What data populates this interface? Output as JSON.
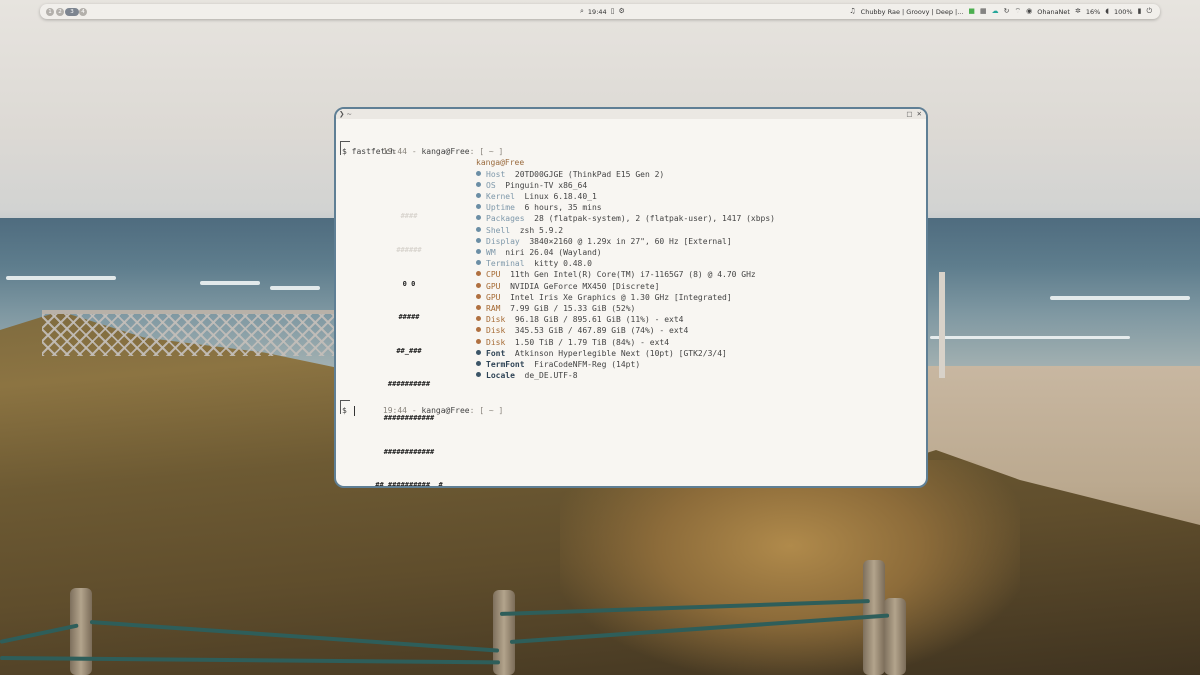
{
  "topbar": {
    "workspaces": [
      "1",
      "2",
      "3",
      "4"
    ],
    "active_workspace": "3",
    "clock": "19:44",
    "media_title": "Chubby Rae | Groovy | Deep |...",
    "network_name": "OhanaNet",
    "brightness": "16%",
    "battery": "100%",
    "icons": [
      "search-icon",
      "clipboard-icon",
      "settings-icon",
      "music-icon",
      "wifi-icon",
      "bluetooth-icon",
      "battery-icon",
      "power-icon"
    ]
  },
  "terminal": {
    "title_left": "❯ ~",
    "prompt1": {
      "time": "19:44",
      "sep": " - ",
      "user": "kanga@Free",
      "colon": ": [ ",
      "dir": "~",
      "close": " ]"
    },
    "command": "$ fastfetch",
    "header": "kanga@Free",
    "logo": [
      "####",
      "######",
      "0 0",
      "#####",
      "##_###",
      "##########",
      "############",
      "############",
      "## ##########  #",
      "###### ####### ######",
      "####### ##### #######",
      "####         #####"
    ],
    "info": [
      {
        "key": "Host",
        "value": "20TD00GJGE (ThinkPad E15 Gen 2)",
        "color": "blue"
      },
      {
        "key": "OS",
        "value": "Pinguin-TV x86_64",
        "color": "blue"
      },
      {
        "key": "Kernel",
        "value": "Linux 6.18.40_1",
        "color": "blue"
      },
      {
        "key": "Uptime",
        "value": "6 hours, 35 mins",
        "color": "blue"
      },
      {
        "key": "Packages",
        "value": "28 (flatpak-system), 2 (flatpak-user), 1417 (xbps)",
        "color": "blue"
      },
      {
        "key": "Shell",
        "value": "zsh 5.9.2",
        "color": "blue"
      },
      {
        "key": "Display",
        "value": "3840×2160 @ 1.29x in 27\", 60 Hz [External]",
        "color": "blue"
      },
      {
        "key": "WM",
        "value": "niri 26.04 (Wayland)",
        "color": "blue"
      },
      {
        "key": "Terminal",
        "value": "kitty 0.48.0",
        "color": "blue"
      },
      {
        "key": "CPU",
        "value": "11th Gen Intel(R) Core(TM) i7-1165G7 (8) @ 4.70 GHz",
        "color": "brown"
      },
      {
        "key": "GPU",
        "value": "NVIDIA GeForce MX450 [Discrete]",
        "color": "brown"
      },
      {
        "key": "GPU",
        "value": "Intel Iris Xe Graphics @ 1.30 GHz [Integrated]",
        "color": "brown"
      },
      {
        "key": "RAM",
        "value": "7.99 GiB / 15.33 GiB (52%)",
        "color": "brown"
      },
      {
        "key": "Disk",
        "value": "96.18 GiB / 895.61 GiB (11%) - ext4",
        "color": "brown"
      },
      {
        "key": "Disk",
        "value": "345.53 GiB / 467.89 GiB (74%) - ext4",
        "color": "brown"
      },
      {
        "key": "Disk",
        "value": "1.50 TiB / 1.79 TiB (84%) - ext4",
        "color": "brown"
      },
      {
        "key": "Font",
        "value": "Atkinson Hyperlegible Next (10pt) [GTK2/3/4]",
        "color": "navy"
      },
      {
        "key": "TermFont",
        "value": "FiraCodeNFM-Reg (14pt)",
        "color": "navy"
      },
      {
        "key": "Locale",
        "value": "de_DE.UTF-8",
        "color": "navy"
      }
    ],
    "prompt2": {
      "time": "19:44",
      "sep": " - ",
      "user": "kanga@Free",
      "colon": ": [ ",
      "dir": "~",
      "close": " ]"
    },
    "prompt_char": "$"
  },
  "colors": {
    "accent_blue": "#6b8ea5",
    "accent_brown": "#a56a34",
    "accent_navy": "#2f4456",
    "border": "#5f7f95"
  }
}
